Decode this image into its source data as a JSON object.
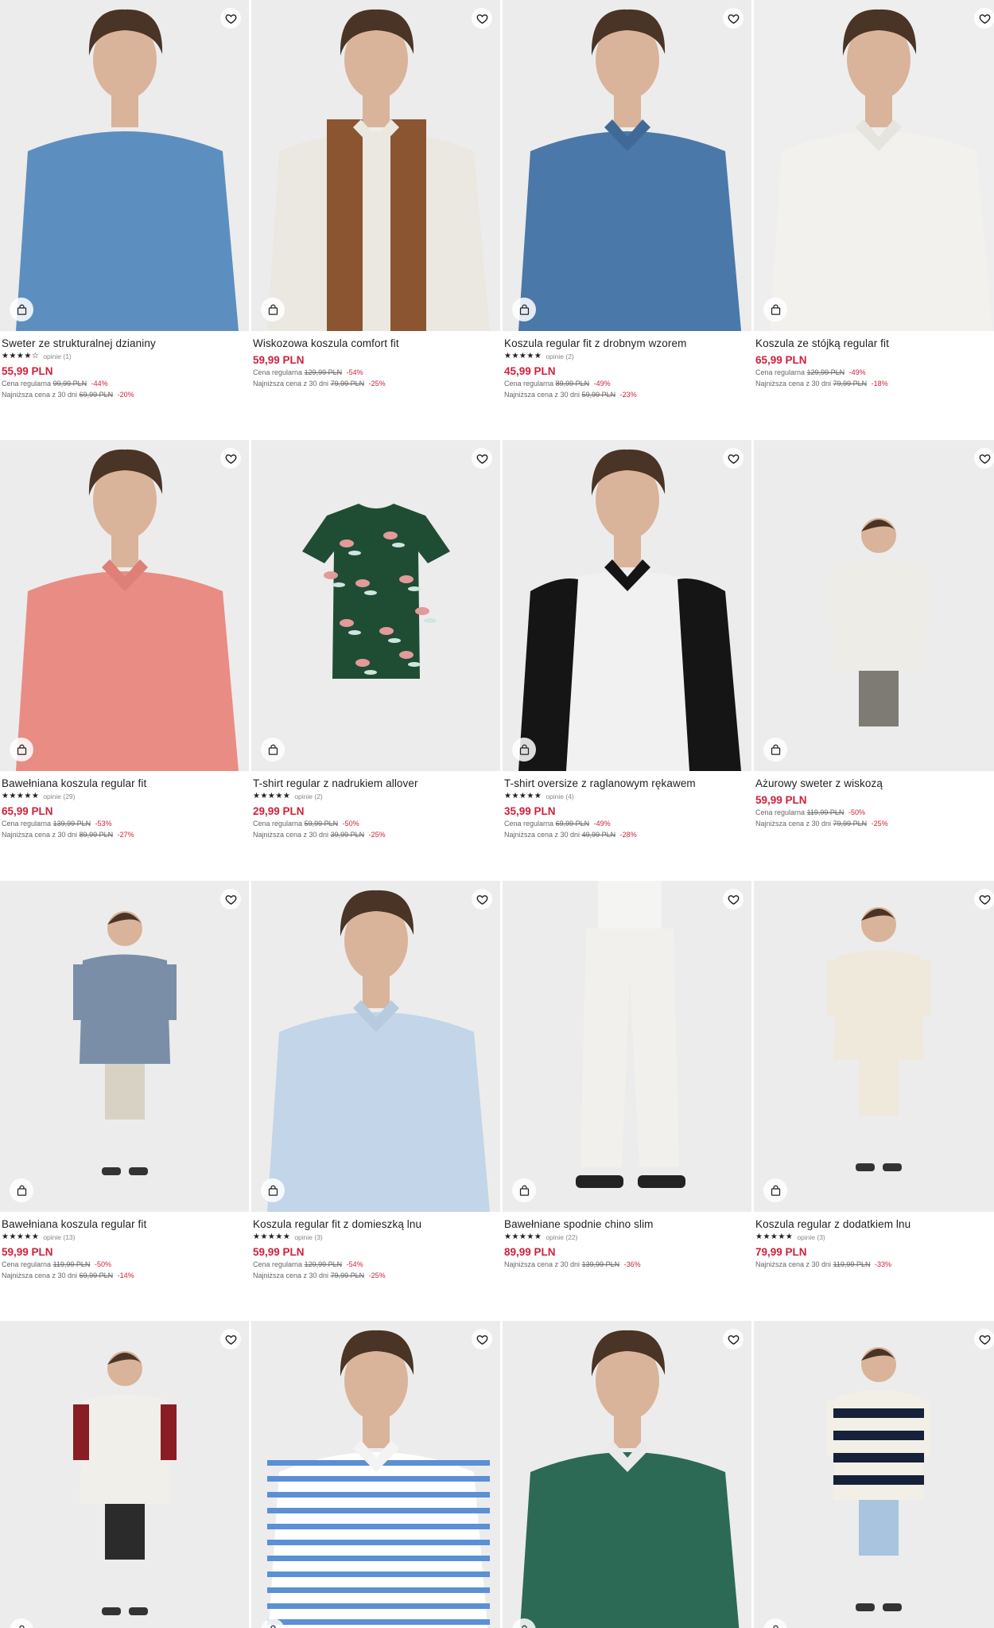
{
  "products": [
    {
      "name": "Sweter ze strukturalnej dzianiny",
      "stars": "★★★★☆",
      "reviews": "opinie (1)",
      "price": "55,99 PLN",
      "regular_label": "Cena regularna",
      "regular_price": "99,99 PLN",
      "regular_discount": "-44%",
      "lowest_label": "Najniższa cena z 30 dni",
      "lowest_price": "69,99 PLN",
      "lowest_discount": "-20%"
    },
    {
      "name": "Wiskozowa koszula comfort fit",
      "stars": "",
      "reviews": "",
      "price": "59,99 PLN",
      "regular_label": "Cena regularna",
      "regular_price": "129,99 PLN",
      "regular_discount": "-54%",
      "lowest_label": "Najniższa cena z 30 dni",
      "lowest_price": "79,99 PLN",
      "lowest_discount": "-25%"
    },
    {
      "name": "Koszula regular fit z drobnym wzorem",
      "stars": "★★★★★",
      "reviews": "opinie (2)",
      "price": "45,99 PLN",
      "regular_label": "Cena regularna",
      "regular_price": "89,99 PLN",
      "regular_discount": "-49%",
      "lowest_label": "Najniższa cena z 30 dni",
      "lowest_price": "59,99 PLN",
      "lowest_discount": "-23%"
    },
    {
      "name": "Koszula ze stójką regular fit",
      "stars": "",
      "reviews": "",
      "price": "65,99 PLN",
      "regular_label": "Cena regularna",
      "regular_price": "129,99 PLN",
      "regular_discount": "-49%",
      "lowest_label": "Najniższa cena z 30 dni",
      "lowest_price": "79,99 PLN",
      "lowest_discount": "-18%"
    },
    {
      "name": "Bawełniana koszula regular fit",
      "stars": "★★★★★",
      "reviews": "opinie (29)",
      "price": "65,99 PLN",
      "regular_label": "Cena regularna",
      "regular_price": "139,99 PLN",
      "regular_discount": "-53%",
      "lowest_label": "Najniższa cena z 30 dni",
      "lowest_price": "89,99 PLN",
      "lowest_discount": "-27%"
    },
    {
      "name": "T-shirt regular z nadrukiem allover",
      "stars": "★★★★★",
      "reviews": "opinie (2)",
      "price": "29,99 PLN",
      "regular_label": "Cena regularna",
      "regular_price": "59,99 PLN",
      "regular_discount": "-50%",
      "lowest_label": "Najniższa cena z 30 dni",
      "lowest_price": "39,99 PLN",
      "lowest_discount": "-25%"
    },
    {
      "name": "T-shirt oversize z raglanowym rękawem",
      "stars": "★★★★★",
      "reviews": "opinie (4)",
      "price": "35,99 PLN",
      "regular_label": "Cena regularna",
      "regular_price": "69,99 PLN",
      "regular_discount": "-49%",
      "lowest_label": "Najniższa cena z 30 dni",
      "lowest_price": "49,99 PLN",
      "lowest_discount": "-28%"
    },
    {
      "name": "Ażurowy sweter z wiskozą",
      "stars": "",
      "reviews": "",
      "price": "59,99 PLN",
      "regular_label": "Cena regularna",
      "regular_price": "119,99 PLN",
      "regular_discount": "-50%",
      "lowest_label": "Najniższa cena z 30 dni",
      "lowest_price": "79,99 PLN",
      "lowest_discount": "-25%"
    },
    {
      "name": "Bawełniana koszula regular fit",
      "stars": "★★★★★",
      "reviews": "opinie (13)",
      "price": "59,99 PLN",
      "regular_label": "Cena regularna",
      "regular_price": "119,99 PLN",
      "regular_discount": "-50%",
      "lowest_label": "Najniższa cena z 30 dni",
      "lowest_price": "69,99 PLN",
      "lowest_discount": "-14%"
    },
    {
      "name": "Koszula regular fit z domieszką lnu",
      "stars": "★★★★★",
      "reviews": "opinie (3)",
      "price": "59,99 PLN",
      "regular_label": "Cena regularna",
      "regular_price": "129,99 PLN",
      "regular_discount": "-54%",
      "lowest_label": "Najniższa cena z 30 dni",
      "lowest_price": "79,99 PLN",
      "lowest_discount": "-25%"
    },
    {
      "name": "Bawełniane spodnie chino slim",
      "stars": "★★★★★",
      "reviews": "opinie (22)",
      "price": "89,99 PLN",
      "regular_label": "",
      "regular_price": "",
      "regular_discount": "",
      "lowest_label": "Najniższa cena z 30 dni",
      "lowest_price": "139,99 PLN",
      "lowest_discount": "-36%"
    },
    {
      "name": "Koszula regular z dodatkiem lnu",
      "stars": "★★★★★",
      "reviews": "opinie (3)",
      "price": "79,99 PLN",
      "regular_label": "",
      "regular_price": "",
      "regular_discount": "",
      "lowest_label": "Najniższa cena z 30 dni",
      "lowest_price": "119,99 PLN",
      "lowest_discount": "-33%"
    },
    {
      "name": "",
      "stars": "",
      "reviews": "",
      "price": "",
      "regular_label": "",
      "regular_price": "",
      "regular_discount": "",
      "lowest_label": "",
      "lowest_price": "",
      "lowest_discount": ""
    },
    {
      "name": "",
      "stars": "",
      "reviews": "",
      "price": "",
      "regular_label": "",
      "regular_price": "",
      "regular_discount": "",
      "lowest_label": "",
      "lowest_price": "",
      "lowest_discount": ""
    },
    {
      "name": "",
      "stars": "",
      "reviews": "",
      "price": "",
      "regular_label": "",
      "regular_price": "",
      "regular_discount": "",
      "lowest_label": "",
      "lowest_price": "",
      "lowest_discount": ""
    },
    {
      "name": "",
      "stars": "",
      "reviews": "",
      "price": "",
      "regular_label": "",
      "regular_price": "",
      "regular_discount": "",
      "lowest_label": "",
      "lowest_price": "",
      "lowest_discount": ""
    }
  ],
  "icons": {
    "wishlist": "heart-icon",
    "add_to_cart": "shopping-bag-icon"
  },
  "colors": {
    "price": "#d0213a",
    "text": "#222222",
    "image_bg": "#ececec"
  }
}
